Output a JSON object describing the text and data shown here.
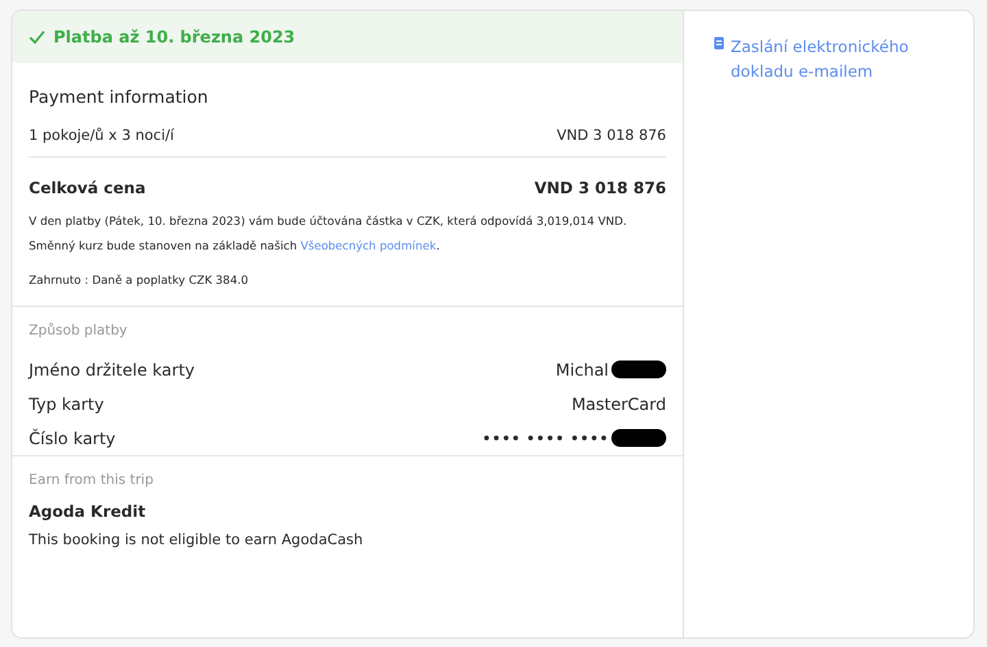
{
  "status_banner": {
    "text": "Platba až 10. března 2023"
  },
  "payment_information": {
    "title": "Payment information",
    "line_item": {
      "label": "1 pokoje/ů x 3 noci/í",
      "amount": "VND 3 018 876"
    },
    "total": {
      "label": "Celková cena",
      "amount": "VND 3 018 876"
    },
    "notes": [
      "V den platby (Pátek, 10. března 2023) vám bude účtována částka v CZK, která odpovídá 3,019,014 VND."
    ],
    "exchange_note": {
      "text": "Směnný kurz bude stanoven na základě našich ",
      "link": "Všeobecných podmínek",
      "end": "."
    },
    "included": "Zahrnuto : Daně a poplatky CZK 384.0"
  },
  "payment_method": {
    "title": "Způsob platby",
    "rows": [
      {
        "label": "Jméno držitele karty",
        "value": "Michal",
        "redacted": true
      },
      {
        "label": "Typ karty",
        "value": "MasterCard",
        "redacted": false
      },
      {
        "label": "Číslo karty",
        "value": "•••• •••• ••••",
        "redacted": true
      }
    ]
  },
  "earn": {
    "title": "Earn from this trip",
    "heading": "Agoda Kredit",
    "text": "This booking is not eligible to earn AgodaCash"
  },
  "sidebar": {
    "link": "Zaslání elektronického dokladu e-mailem"
  }
}
